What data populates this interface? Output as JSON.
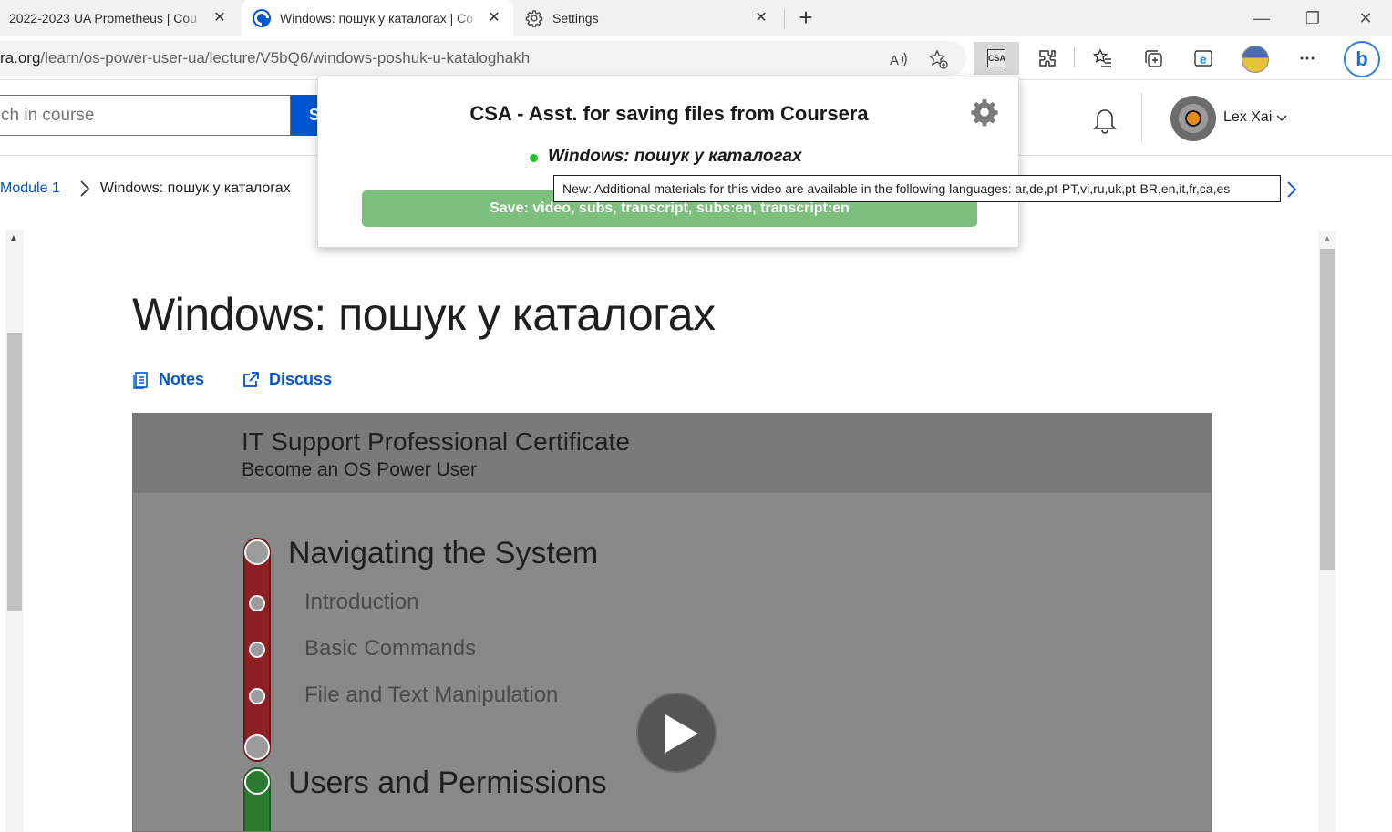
{
  "browser": {
    "tabs": [
      {
        "label": "2022-2023 UA Prometheus | Cou",
        "close": "✕"
      },
      {
        "label": "Windows: пошук у каталогах | Co",
        "close": "✕"
      },
      {
        "label": "Settings",
        "close": "✕"
      }
    ],
    "new_tab": "+",
    "window_controls": {
      "minimize": "—",
      "restore": "❐",
      "close": "✕"
    },
    "address": {
      "host": "ra.org",
      "path": "/learn/os-power-user-ua/lecture/V5bQ6/windows-poshuk-u-kataloghakh"
    },
    "extension_badge": "CSA",
    "bing_label": "b",
    "accent": "#0056d2"
  },
  "header": {
    "search_placeholder": "ch in course",
    "search_button": "S",
    "user_name": "Lex Xai"
  },
  "breadcrumb": {
    "module": "Module 1",
    "current": "Windows: пошук у каталогах"
  },
  "lecture": {
    "title": "Windows: пошук у каталогах",
    "notes": "Notes",
    "discuss": "Discuss"
  },
  "video": {
    "header_title": "IT Support Professional Certificate",
    "header_subtitle": "Become an OS Power User",
    "section1": "Navigating the System",
    "items": [
      "Introduction",
      "Basic Commands",
      "File and Text Manipulation"
    ],
    "section2": "Users and Permissions",
    "track_colors": {
      "red": "#8f1f25",
      "green": "#2a7a2f"
    }
  },
  "popup": {
    "title": "CSA - Asst. for saving files from Coursera",
    "video_name": "Windows: пошук у каталогах",
    "save_button": "Save: video, subs, transcript, subs:en, transcript:en",
    "tooltip": "New: Additional materials for this video are available in the following languages: ar,de,pt-PT,vi,ru,uk,pt-BR,en,it,fr,ca,es",
    "status_color": "#22c322"
  }
}
